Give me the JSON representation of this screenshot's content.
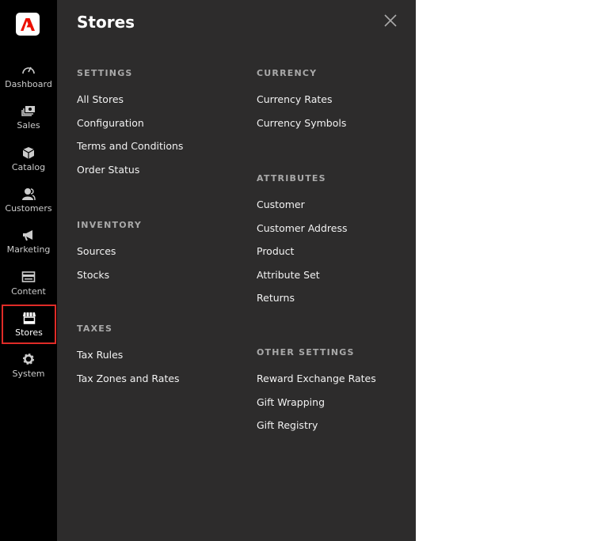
{
  "sidebar": {
    "items": [
      {
        "label": "Dashboard",
        "icon": "dashboard-icon"
      },
      {
        "label": "Sales",
        "icon": "sales-icon"
      },
      {
        "label": "Catalog",
        "icon": "catalog-icon"
      },
      {
        "label": "Customers",
        "icon": "customers-icon"
      },
      {
        "label": "Marketing",
        "icon": "marketing-icon"
      },
      {
        "label": "Content",
        "icon": "content-icon"
      },
      {
        "label": "Stores",
        "icon": "stores-icon",
        "active": true
      },
      {
        "label": "System",
        "icon": "system-icon"
      }
    ],
    "accent": "#e02b27"
  },
  "panel": {
    "title": "Stores",
    "sections": [
      {
        "heading": "SETTINGS",
        "items": [
          "All Stores",
          "Configuration",
          "Terms and Conditions",
          "Order Status"
        ]
      },
      {
        "heading": "INVENTORY",
        "items": [
          "Sources",
          "Stocks"
        ]
      },
      {
        "heading": "TAXES",
        "items": [
          "Tax Rules",
          "Tax Zones and Rates"
        ]
      },
      {
        "heading": "CURRENCY",
        "items": [
          "Currency Rates",
          "Currency Symbols"
        ]
      },
      {
        "heading": "ATTRIBUTES",
        "items": [
          "Customer",
          "Customer Address",
          "Product",
          "Attribute Set",
          "Returns"
        ]
      },
      {
        "heading": "OTHER SETTINGS",
        "items": [
          "Reward Exchange Rates",
          "Gift Wrapping",
          "Gift Registry"
        ]
      }
    ]
  }
}
